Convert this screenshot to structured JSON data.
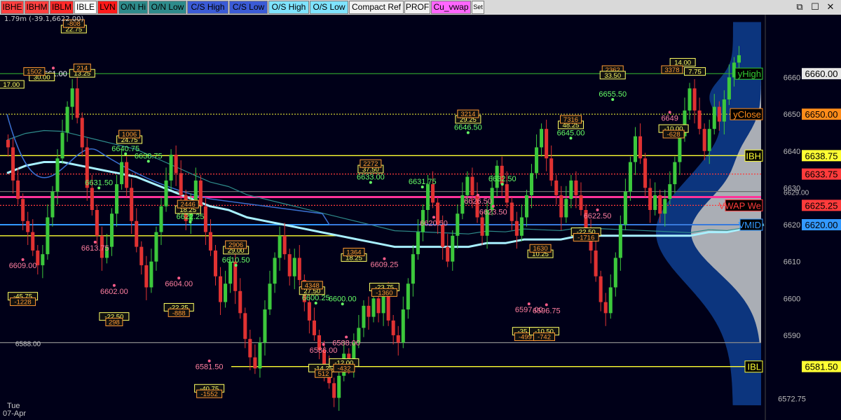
{
  "toolbar": {
    "buttons": [
      {
        "label": "IBHE",
        "bg": "#ff4040",
        "fg": "#000000"
      },
      {
        "label": "IBHM",
        "bg": "#ff4040",
        "fg": "#000000"
      },
      {
        "label": "IBLM",
        "bg": "#ff2a2a",
        "fg": "#000000"
      },
      {
        "label": "IBLE",
        "bg": "#ffffff",
        "fg": "#000000"
      },
      {
        "label": "LVN",
        "bg": "#ff1a1a",
        "fg": "#000000"
      },
      {
        "label": "O/N Hi",
        "bg": "#2e8b8b",
        "fg": "#000000"
      },
      {
        "label": "O/N Low",
        "bg": "#2e8b8b",
        "fg": "#000000"
      },
      {
        "label": "C/S High",
        "bg": "#3b5bd6",
        "fg": "#000000"
      },
      {
        "label": "C/S Low",
        "bg": "#3b5bd6",
        "fg": "#000000"
      },
      {
        "label": "O/S High",
        "bg": "#7fe3ff",
        "fg": "#000000"
      },
      {
        "label": "O/S Low",
        "bg": "#7fe3ff",
        "fg": "#000000"
      },
      {
        "label": "Compact Ref",
        "bg": "#f2f2f2",
        "fg": "#000000"
      },
      {
        "label": "PROF",
        "bg": "#f2f2f2",
        "fg": "#000000"
      },
      {
        "label": "Cu_vwap",
        "bg": "#ff66ff",
        "fg": "#000000"
      },
      {
        "label": "Set",
        "bg": "#f2f2f2",
        "fg": "#000000"
      }
    ],
    "window_controls": [
      "⧉",
      "☐",
      "✕"
    ]
  },
  "chart_info": "1.79m (-39.1,6622.00)",
  "date_labels": {
    "weekday": "Tue",
    "date": "07-Apr"
  },
  "chart_data": {
    "type": "candlestick",
    "ylim": [
      6567,
      6677
    ],
    "price_axis_ticks": [
      6572.75,
      6590,
      6600,
      6610,
      6620,
      6630,
      6640,
      6650,
      6660
    ],
    "levels": [
      {
        "name": "yHigh",
        "value": 6661.0,
        "color": "#2d9a2d",
        "label_color": "#33cc33",
        "right_label": "yHigh",
        "price_label": "6660.00"
      },
      {
        "name": "yClose",
        "value": 6650.0,
        "color": "#cccc33",
        "label_color": "#ff8c1a",
        "right_label": "yClose",
        "price_label": "6650.00"
      },
      {
        "name": "IBH",
        "value": 6638.75,
        "color": "#ffff33",
        "label_color": "#ffff33",
        "right_label": "IBH",
        "price_label": "6638.75"
      },
      {
        "name": "IBHM",
        "value": 6633.75,
        "color": "#ff3b3b",
        "label_color": "#ff3b3b",
        "right_label": "",
        "price_label": "6633.75"
      },
      {
        "name": "6629",
        "value": 6629.0,
        "color": "#6b6b6b",
        "label_color": "#bbbbbb",
        "right_label": "",
        "price_label": "6629.00"
      },
      {
        "name": "Cu_vwap",
        "value": 6627.5,
        "color": "#ff3399",
        "label_color": "#ff3399",
        "right_label": "",
        "price_label": ""
      },
      {
        "name": "VWAP",
        "value": 6625.25,
        "color": "#ff3b3b",
        "label_color": "#ff3b3b",
        "right_label": "VWAP We",
        "price_label": "6625.25"
      },
      {
        "name": "VMID",
        "value": 6620.0,
        "color": "#3399ff",
        "label_color": "#3399ff",
        "right_label": "VMID",
        "price_label": "6620.00"
      },
      {
        "name": "IBL",
        "value": 6581.5,
        "color": "#ffff33",
        "label_color": "#ffff33",
        "right_label": "IBL",
        "price_label": "6581.50"
      },
      {
        "name": "6588",
        "value": 6588.0,
        "color": "#8a8a8a",
        "label_color": "#cccccc",
        "right_label": "6588.00",
        "price_label": ""
      },
      {
        "name": "IBL-ext",
        "value": 6617.0,
        "color": "#ffff33",
        "label_color": "#ffff33",
        "right_label": "",
        "price_label": ""
      }
    ],
    "candles_close": [
      6641,
      6632,
      6627,
      6621,
      6618,
      6613,
      6609,
      6612,
      6622,
      6629,
      6638,
      6645,
      6652,
      6657,
      6649,
      6641,
      6630,
      6624,
      6617,
      6611,
      6614,
      6623,
      6631,
      6637,
      6630,
      6621,
      6614,
      6609,
      6603,
      6610,
      6618,
      6625,
      6632,
      6639,
      6634,
      6628,
      6621,
      6626,
      6632,
      6625,
      6618,
      6613,
      6606,
      6599,
      6604,
      6610,
      6602,
      6596,
      6589,
      6584,
      6581,
      6588,
      6597,
      6604,
      6611,
      6617,
      6612,
      6606,
      6611,
      6605,
      6599,
      6594,
      6590,
      6586,
      6581,
      6577,
      6573,
      6579,
      6585,
      6582,
      6588,
      6592,
      6598,
      6595,
      6600,
      6596,
      6601,
      6594,
      6590,
      6588,
      6597,
      6604,
      6612,
      6618,
      6624,
      6631,
      6626,
      6620,
      6614,
      6610,
      6617,
      6623,
      6628,
      6633,
      6628,
      6622,
      6617,
      6624,
      6630,
      6636,
      6631,
      6626,
      6621,
      6617,
      6622,
      6628,
      6634,
      6641,
      6646,
      6638,
      6632,
      6628,
      6622,
      6627,
      6632,
      6628,
      6624,
      6619,
      6613,
      6606,
      6599,
      6596,
      6603,
      6611,
      6620,
      6629,
      6637,
      6644,
      6638,
      6630,
      6624,
      6628,
      6623,
      6627,
      6631,
      6637,
      6644,
      6651,
      6657,
      6651,
      6646,
      6640,
      6646,
      6652,
      6648,
      6654,
      6660,
      6664,
      6666
    ],
    "vwap_band": [
      6634,
      6636,
      6637,
      6637,
      6636,
      6635,
      6634,
      6633,
      6631,
      6629,
      6627,
      6625,
      6624,
      6622,
      6621,
      6620,
      6619,
      6618,
      6617,
      6616,
      6615,
      6614,
      6614,
      6614,
      6614,
      6614,
      6615,
      6615,
      6616,
      6616,
      6616,
      6617,
      6617,
      6617,
      6617,
      6617,
      6617,
      6617,
      6618,
      6618,
      6619,
      6620
    ],
    "annotations": [
      {
        "value": 6661.0,
        "text": "6661.00",
        "x_frac": 0.07,
        "color": "#ffffff"
      },
      {
        "value": 6609.0,
        "text": "6609.00",
        "x_frac": 0.03,
        "color": "#ff7fa0"
      },
      {
        "value": 6613.75,
        "text": "6613.75",
        "x_frac": 0.125,
        "color": "#ff7fa0"
      },
      {
        "value": 6602.0,
        "text": "6602.00",
        "x_frac": 0.15,
        "color": "#ff7fa0"
      },
      {
        "value": 6640.75,
        "text": "6640.75",
        "x_frac": 0.165,
        "color": "#66ff66"
      },
      {
        "value": 6638.75,
        "text": "6638.75",
        "x_frac": 0.195,
        "color": "#66ff66"
      },
      {
        "value": 6631.5,
        "text": "6631.50",
        "x_frac": 0.13,
        "color": "#66ff66"
      },
      {
        "value": 6622.25,
        "text": "6622.25",
        "x_frac": 0.25,
        "color": "#66ff66"
      },
      {
        "value": 6604.0,
        "text": "6604.00",
        "x_frac": 0.235,
        "color": "#ff7fa0"
      },
      {
        "value": 6581.5,
        "text": "6581.50",
        "x_frac": 0.275,
        "color": "#ff7fa0"
      },
      {
        "value": 6610.5,
        "text": "6610.50",
        "x_frac": 0.31,
        "color": "#66ff66"
      },
      {
        "value": 6600.25,
        "text": "6600.25",
        "x_frac": 0.415,
        "color": "#66ff66"
      },
      {
        "value": 6600.0,
        "text": "6600.00",
        "x_frac": 0.45,
        "color": "#66ff66"
      },
      {
        "value": 6586.0,
        "text": "6586.00",
        "x_frac": 0.425,
        "color": "#ff7fa0"
      },
      {
        "value": 6588.0,
        "text": "6588.00",
        "x_frac": 0.455,
        "color": "#ff7fa0"
      },
      {
        "value": 6633.0,
        "text": "6633.00",
        "x_frac": 0.487,
        "color": "#66ff66"
      },
      {
        "value": 6609.25,
        "text": "6609.25",
        "x_frac": 0.505,
        "color": "#ff7fa0"
      },
      {
        "value": 6620.5,
        "text": "6620.50",
        "x_frac": 0.57,
        "color": "#ff7fa0"
      },
      {
        "value": 6631.75,
        "text": "6631.75",
        "x_frac": 0.555,
        "color": "#66ff66"
      },
      {
        "value": 6646.5,
        "text": "6646.50",
        "x_frac": 0.615,
        "color": "#66ff66"
      },
      {
        "value": 6626.5,
        "text": "6626.50",
        "x_frac": 0.628,
        "color": "#ff7fa0"
      },
      {
        "value": 6632.5,
        "text": "6632.50",
        "x_frac": 0.66,
        "color": "#66ff66"
      },
      {
        "value": 6623.5,
        "text": "6623.50",
        "x_frac": 0.648,
        "color": "#ff7fa0"
      },
      {
        "value": 6597.0,
        "text": "6597.00",
        "x_frac": 0.695,
        "color": "#ff7fa0"
      },
      {
        "value": 6596.75,
        "text": "6596.75",
        "x_frac": 0.718,
        "color": "#ff7fa0"
      },
      {
        "value": 6645.0,
        "text": "6645.00",
        "x_frac": 0.75,
        "color": "#66ff66"
      },
      {
        "value": 6622.5,
        "text": "6622.50",
        "x_frac": 0.785,
        "color": "#ff7fa0"
      },
      {
        "value": 6655.5,
        "text": "6655.50",
        "x_frac": 0.805,
        "color": "#66ff66"
      },
      {
        "value": 6649.0,
        "text": "6649",
        "x_frac": 0.88,
        "color": "#ff7fa0"
      }
    ],
    "data_boxes": [
      {
        "value": 6664,
        "text": "14.00",
        "x_frac": 0.897,
        "color": "#ffff66"
      },
      {
        "value": 6662,
        "text": "3378",
        "x_frac": 0.883,
        "color": "#ff9933"
      },
      {
        "value": 6661.5,
        "text": "7.75",
        "x_frac": 0.913,
        "color": "#ffff66"
      },
      {
        "value": 6662,
        "text": "2362",
        "x_frac": 0.805,
        "color": "#ff9933"
      },
      {
        "value": 6660.5,
        "text": "33.50",
        "x_frac": 0.805,
        "color": "#ffff66"
      },
      {
        "value": 6648.5,
        "text": "29.25",
        "x_frac": 0.615,
        "color": "#ffff66"
      },
      {
        "value": 6650,
        "text": "3214",
        "x_frac": 0.615,
        "color": "#ff9933"
      },
      {
        "value": 6647,
        "text": "48.25",
        "x_frac": 0.75,
        "color": "#ffff66"
      },
      {
        "value": 6648.5,
        "text": "7316",
        "x_frac": 0.75,
        "color": "#ff9933"
      },
      {
        "value": 6635,
        "text": "37.50",
        "x_frac": 0.487,
        "color": "#ffff66"
      },
      {
        "value": 6636.5,
        "text": "2272",
        "x_frac": 0.487,
        "color": "#ff9933"
      },
      {
        "value": 6643,
        "text": "24.75",
        "x_frac": 0.17,
        "color": "#ffff66"
      },
      {
        "value": 6644.5,
        "text": "1006",
        "x_frac": 0.17,
        "color": "#ff9933"
      },
      {
        "value": 6611,
        "text": "18.25",
        "x_frac": 0.465,
        "color": "#ffff66"
      },
      {
        "value": 6612.5,
        "text": "1364",
        "x_frac": 0.465,
        "color": "#ff9933"
      },
      {
        "value": 6602,
        "text": "27.50",
        "x_frac": 0.41,
        "color": "#ffff66"
      },
      {
        "value": 6603.5,
        "text": "4348",
        "x_frac": 0.41,
        "color": "#ff9933"
      },
      {
        "value": 6624,
        "text": "18.25",
        "x_frac": 0.247,
        "color": "#ffff66"
      },
      {
        "value": 6625.5,
        "text": "2446",
        "x_frac": 0.247,
        "color": "#ff9933"
      },
      {
        "value": 6613,
        "text": "29.00",
        "x_frac": 0.31,
        "color": "#ffff66"
      },
      {
        "value": 6614.5,
        "text": "2906",
        "x_frac": 0.31,
        "color": "#ff9933"
      },
      {
        "value": 6612,
        "text": "10.25",
        "x_frac": 0.71,
        "color": "#ffff66"
      },
      {
        "value": 6613.5,
        "text": "1630",
        "x_frac": 0.71,
        "color": "#ff9933"
      },
      {
        "value": 6661,
        "text": "13.25",
        "x_frac": 0.108,
        "color": "#ffff66"
      },
      {
        "value": 6662.5,
        "text": "214",
        "x_frac": 0.108,
        "color": "#ff9933"
      },
      {
        "value": 6673,
        "text": "22.75",
        "x_frac": 0.097,
        "color": "#ffff66"
      },
      {
        "value": 6674.5,
        "text": "-808",
        "x_frac": 0.097,
        "color": "#ff9933"
      },
      {
        "value": 6660,
        "text": "30.00",
        "x_frac": 0.055,
        "color": "#ffff66"
      },
      {
        "value": 6661.5,
        "text": "1502",
        "x_frac": 0.045,
        "color": "#ff9933"
      },
      {
        "value": 6658,
        "text": "17.00",
        "x_frac": 0.015,
        "color": "#ffff66"
      },
      {
        "value": 6600.5,
        "text": "-45.75",
        "x_frac": 0.03,
        "color": "#ffff66"
      },
      {
        "value": 6599,
        "text": "-1228",
        "x_frac": 0.03,
        "color": "#ff9933"
      },
      {
        "value": 6595,
        "text": "-22.50",
        "x_frac": 0.15,
        "color": "#ffff66"
      },
      {
        "value": 6593.5,
        "text": "298",
        "x_frac": 0.15,
        "color": "#ff9933"
      },
      {
        "value": 6597.5,
        "text": "-22.25",
        "x_frac": 0.235,
        "color": "#ffff66"
      },
      {
        "value": 6596,
        "text": "-888",
        "x_frac": 0.235,
        "color": "#ff9933"
      },
      {
        "value": 6575.5,
        "text": "-40.75",
        "x_frac": 0.275,
        "color": "#ffff66"
      },
      {
        "value": 6574,
        "text": "-1552",
        "x_frac": 0.275,
        "color": "#ff9933"
      },
      {
        "value": 6581,
        "text": "-14.25",
        "x_frac": 0.425,
        "color": "#ffff66"
      },
      {
        "value": 6579.5,
        "text": "512",
        "x_frac": 0.425,
        "color": "#ff9933"
      },
      {
        "value": 6582.5,
        "text": "-12.00",
        "x_frac": 0.452,
        "color": "#ffff66"
      },
      {
        "value": 6581,
        "text": "-432",
        "x_frac": 0.452,
        "color": "#ff9933"
      },
      {
        "value": 6603,
        "text": "-23.75",
        "x_frac": 0.505,
        "color": "#ffff66"
      },
      {
        "value": 6601.5,
        "text": "-1360",
        "x_frac": 0.505,
        "color": "#ff9933"
      },
      {
        "value": 6591,
        "text": "-35.1",
        "x_frac": 0.69,
        "color": "#ffff66"
      },
      {
        "value": 6589.5,
        "text": "-499",
        "x_frac": 0.69,
        "color": "#ff9933"
      },
      {
        "value": 6591,
        "text": "-10.50",
        "x_frac": 0.715,
        "color": "#ffff66"
      },
      {
        "value": 6589.5,
        "text": "-742",
        "x_frac": 0.715,
        "color": "#ff9933"
      },
      {
        "value": 6618,
        "text": "-22.50",
        "x_frac": 0.77,
        "color": "#ffff66"
      },
      {
        "value": 6616.5,
        "text": "-1716",
        "x_frac": 0.77,
        "color": "#ff9933"
      },
      {
        "value": 6646,
        "text": "-10.00",
        "x_frac": 0.885,
        "color": "#ffff66"
      },
      {
        "value": 6644.5,
        "text": "-628",
        "x_frac": 0.885,
        "color": "#ff9933"
      }
    ],
    "volume_profile": {
      "peak_value": 6618,
      "low_value": 6600,
      "color": "#bbbbbb",
      "outer_color": "#0d3b8a"
    }
  }
}
